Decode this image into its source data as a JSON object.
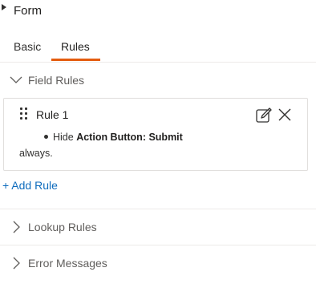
{
  "form": {
    "title": "Form"
  },
  "tabs": [
    {
      "label": "Basic",
      "active": false
    },
    {
      "label": "Rules",
      "active": true
    }
  ],
  "sections": {
    "field_rules": {
      "label": "Field Rules",
      "expanded": true,
      "icon": "chevron-down-icon"
    },
    "lookup_rules": {
      "label": "Lookup Rules",
      "expanded": false,
      "icon": "chevron-right-icon"
    },
    "error_messages": {
      "label": "Error Messages",
      "expanded": false,
      "icon": "chevron-right-icon"
    }
  },
  "rule": {
    "title": "Rule 1",
    "action": "Hide",
    "target": "Action Button: Submit",
    "condition": "always."
  },
  "add_rule_label": "+ Add Rule",
  "colors": {
    "accent_underline": "#e45c0f",
    "link": "#0f6cbd",
    "border": "#e1dfdd"
  }
}
